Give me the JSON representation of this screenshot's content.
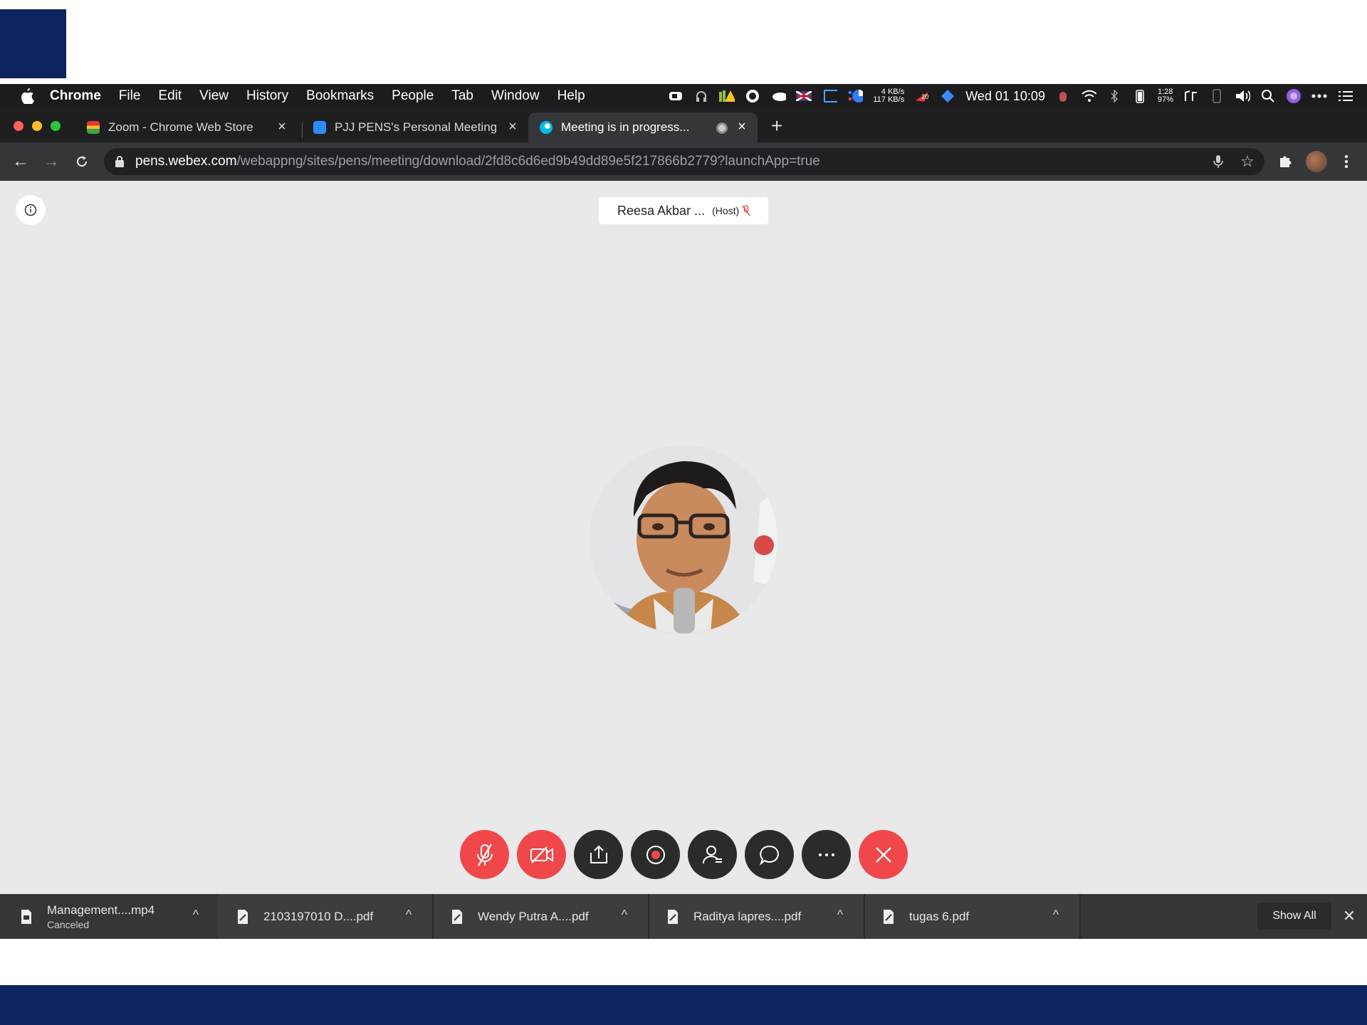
{
  "menubar": {
    "app_name": "Chrome",
    "items": [
      "File",
      "Edit",
      "View",
      "History",
      "Bookmarks",
      "People",
      "Tab",
      "Window",
      "Help"
    ],
    "net_up": "4 KB/s",
    "net_down": "117 KB/s",
    "badge_count": "20",
    "clock": "Wed 01 10:09",
    "battery_time": "1:28",
    "battery_pct": "97%"
  },
  "tabs": [
    {
      "title": "Zoom - Chrome Web Store",
      "active": false
    },
    {
      "title": "PJJ PENS's Personal Meeting R",
      "active": false
    },
    {
      "title": "Meeting is in progress...",
      "active": true
    }
  ],
  "address": {
    "host": "pens.webex.com",
    "path": "/webappng/sites/pens/meeting/download/2fd8c6d6ed9b49dd89e5f217866b2779?launchApp=true"
  },
  "meeting": {
    "participant_name": "Reesa Akbar ...",
    "host_tag": "(Host)"
  },
  "controls": [
    {
      "name": "mute",
      "icon": "mic-off-icon",
      "color": "#f0484a"
    },
    {
      "name": "video",
      "icon": "video-off-icon",
      "color": "#f0484a"
    },
    {
      "name": "share",
      "icon": "share-icon",
      "color": "#2b2b2b"
    },
    {
      "name": "record",
      "icon": "record-icon",
      "color": "#2b2b2b"
    },
    {
      "name": "participants",
      "icon": "participants-icon",
      "color": "#2b2b2b"
    },
    {
      "name": "chat",
      "icon": "chat-icon",
      "color": "#2b2b2b"
    },
    {
      "name": "more",
      "icon": "more-icon",
      "color": "#2b2b2b"
    },
    {
      "name": "leave",
      "icon": "close-icon",
      "color": "#f0484a"
    }
  ],
  "downloads": {
    "items": [
      {
        "name": "Management....mp4",
        "status": "Canceled"
      },
      {
        "name": "2103197010 D....pdf"
      },
      {
        "name": "Wendy Putra A....pdf"
      },
      {
        "name": "Raditya lapres....pdf"
      },
      {
        "name": "tugas 6.pdf"
      }
    ],
    "show_all": "Show All"
  }
}
